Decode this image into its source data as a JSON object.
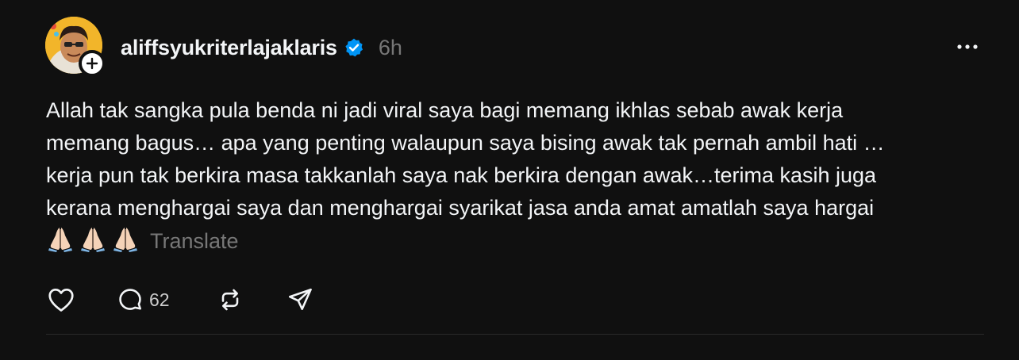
{
  "post": {
    "username": "aliffsyukriterlajaklaris",
    "verified": true,
    "time": "6h",
    "text_lines": [
      "Allah tak sangka pula benda ni jadi viral saya bagi memang ikhlas sebab awak kerja",
      "memang bagus… apa yang penting walaupun saya bising awak tak pernah ambil hati …",
      "kerja pun tak berkira masa takkanlah saya nak berkira dengan awak…terima kasih juga",
      "kerana menghargai saya dan menghargai syarikat jasa anda amat amatlah saya hargai"
    ],
    "emojis": [
      "folded-hands-icon",
      "folded-hands-icon",
      "folded-hands-icon"
    ],
    "translate_label": "Translate",
    "reply_count": "62"
  },
  "colors": {
    "background": "#101010",
    "text": "#f3f5f7",
    "secondary": "#777777",
    "verified": "#0095f6"
  },
  "icons": {
    "like": "heart-icon",
    "reply": "comment-icon",
    "repost": "repost-icon",
    "share": "send-icon",
    "more": "more-icon",
    "follow": "plus-icon"
  }
}
